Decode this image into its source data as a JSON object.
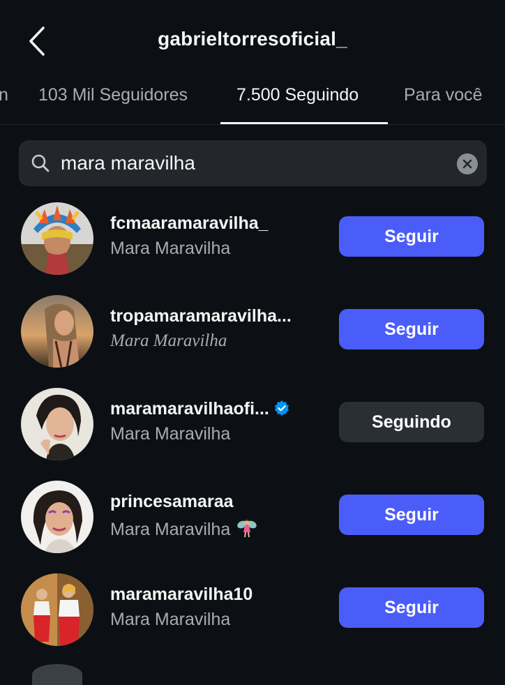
{
  "header": {
    "title": "gabrieltorresoficial_"
  },
  "tabs": [
    {
      "label": "n"
    },
    {
      "label": "103 Mil Seguidores"
    },
    {
      "label": "7.500 Seguindo",
      "active": true
    },
    {
      "label": "Para você"
    }
  ],
  "search": {
    "value": "mara maravilha"
  },
  "colors": {
    "follow": "#4a5df9",
    "following": "#2a2f35",
    "verified": "#0095f6",
    "background": "#0c1014"
  },
  "users": [
    {
      "username": "fcmaaramaravilha_",
      "fullname": "Mara Maravilha",
      "button": "Seguir"
    },
    {
      "username": "tropamaramaravilha...",
      "fullname": "Mara Maravilha",
      "button": "Seguir"
    },
    {
      "username": "maramaravilhaofi...",
      "fullname": "Mara Maravilha",
      "button": "Seguindo",
      "verified": true
    },
    {
      "username": "princesamaraa",
      "fullname": "Mara Maravilha",
      "button": "Seguir",
      "emoji": "fairy"
    },
    {
      "username": "maramaravilha10",
      "fullname": "Mara Maravilha",
      "button": "Seguir"
    }
  ]
}
